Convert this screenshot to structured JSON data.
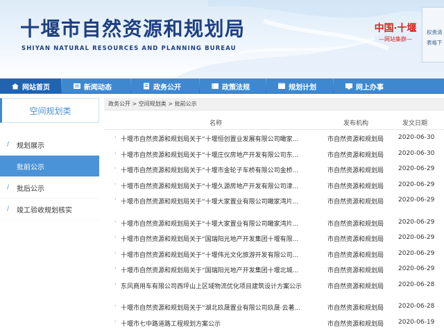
{
  "header": {
    "title": "十堰市自然资源和规划局",
    "subtitle": "SHIYAN NATURAL RESOURCES AND PLANNING BUREAU",
    "group_logo_line1": "中国·十堰",
    "group_logo_line2": "—网站集群—",
    "side_panel": [
      "权责清",
      "表格下"
    ]
  },
  "nav": {
    "items": [
      {
        "label": "网站首页",
        "icon": "home-icon"
      },
      {
        "label": "新闻动态",
        "icon": "news-icon"
      },
      {
        "label": "政务公开",
        "icon": "document-icon"
      },
      {
        "label": "政策法规",
        "icon": "policy-icon"
      },
      {
        "label": "规划计划",
        "icon": "plan-icon"
      },
      {
        "label": "网上办事",
        "icon": "service-icon"
      }
    ]
  },
  "sidebar": {
    "title": "空间规划类",
    "items": [
      {
        "label": "规划展示"
      },
      {
        "label": "批前公示"
      },
      {
        "label": "批后公示"
      },
      {
        "label": "竣工验收规划核实"
      }
    ]
  },
  "breadcrumb": "政务公开 > 空间规划类 > 批前公示",
  "table": {
    "headers": {
      "name": "名称",
      "org": "发布机构",
      "date": "发文日期"
    },
    "rows": [
      {
        "name": "十堰市自然资源和规划局关于“十堰恒创置业发展有限公司瞰家...",
        "org": "市自然资源和规划局",
        "date": "2020-06-30"
      },
      {
        "name": "十堰市自然资源和规划局关于“十堰庄仪房地产开发有限公司东...",
        "org": "市自然资源和规划局",
        "date": "2020-06-30"
      },
      {
        "name": "十堰市自然资源和规划局关于“十堰市金轮子车桥有限公司金桥...",
        "org": "市自然资源和规划局",
        "date": "2020-06-29"
      },
      {
        "name": "十堰市自然资源和规划局关于“十堰久源房地产开发有限公司津...",
        "org": "市自然资源和规划局",
        "date": "2020-06-29"
      },
      {
        "name": "十堰市自然资源和规划局关于“十堰大家置业有限公司瞰家湾片...",
        "org": "市自然资源和规划局",
        "date": "2020-06-29"
      },
      {
        "name": "十堰市自然资源和规划局关于“十堰大家置业有限公司瞰家湾片...",
        "org": "市自然资源和规划局",
        "date": "2020-06-29"
      },
      {
        "name": "十堰市自然资源和规划局关于“国瑞阳光地产开发集团十堰有限...",
        "org": "市自然资源和规划局",
        "date": "2020-06-29"
      },
      {
        "name": "十堰市自然资源和规划局关于“十堰伟光文化旅游开发有限公司...",
        "org": "市自然资源和规划局",
        "date": "2020-06-29"
      },
      {
        "name": "十堰市自然资源和规划局关于“国瑞阳光地产开发集团十堰北城...",
        "org": "市自然资源和规划局",
        "date": "2020-06-29"
      },
      {
        "name": "东风商用车有限公司西坪山上区域物流优化项目建筑设计方案公示",
        "org": "市自然资源和规划局",
        "date": "2020-06-28"
      },
      {
        "name": "十堰市自然资源和规划局关于“湖北玖晟置业有限公司玖晟·云著...",
        "org": "市自然资源和规划局",
        "date": "2020-06-28"
      },
      {
        "name": "十堰市七中路道路工程规划方案公示",
        "org": "市自然资源和规划局",
        "date": "2020-06-19"
      }
    ]
  }
}
